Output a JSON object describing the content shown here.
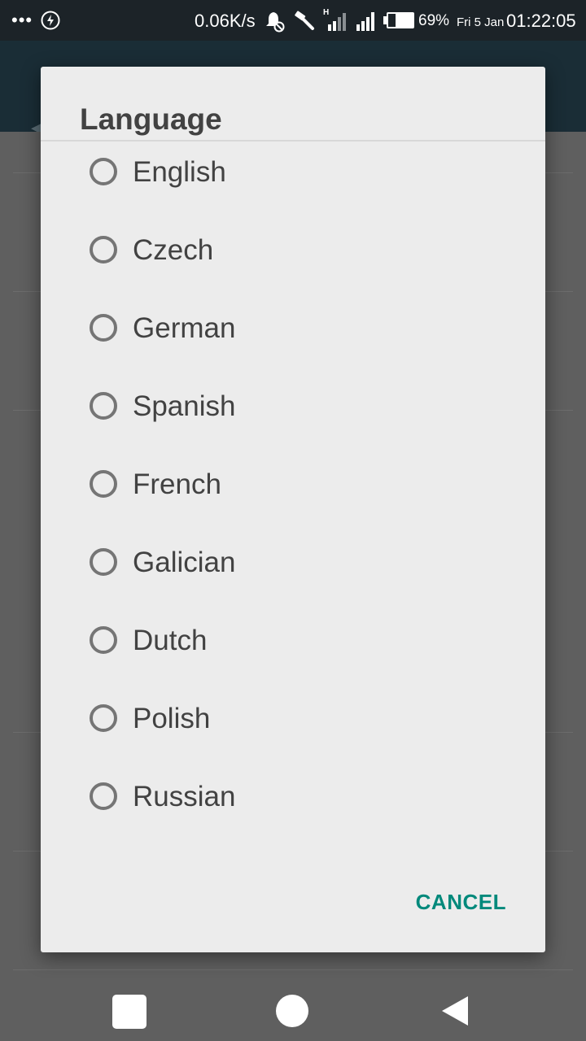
{
  "status_bar": {
    "dots": "•••",
    "net_speed": "0.06K/s",
    "signal_type": "H",
    "battery_percent": "69%",
    "date": "Fri 5 Jan",
    "time": "01:22:05"
  },
  "dialog": {
    "title": "Language",
    "options": [
      {
        "label": "English"
      },
      {
        "label": "Czech"
      },
      {
        "label": "German"
      },
      {
        "label": "Spanish"
      },
      {
        "label": "French"
      },
      {
        "label": "Galician"
      },
      {
        "label": "Dutch"
      },
      {
        "label": "Polish"
      },
      {
        "label": "Russian"
      }
    ],
    "cancel_label": "CANCEL"
  },
  "colors": {
    "accent": "#00897b",
    "dialog_bg": "#ececec",
    "status_bar_bg": "#1c2328"
  }
}
